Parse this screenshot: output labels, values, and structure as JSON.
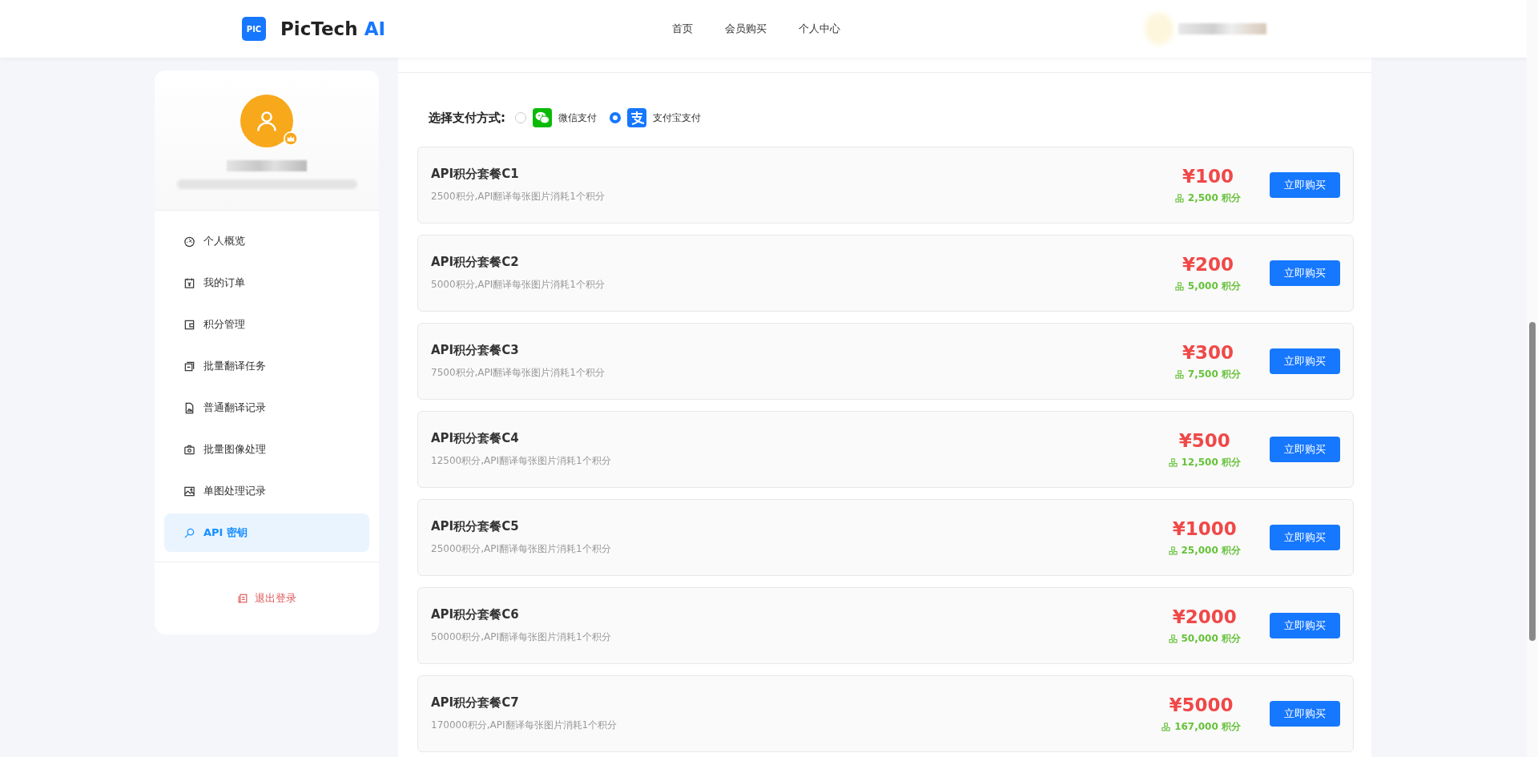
{
  "header": {
    "logo_mark": "PIC",
    "logo_text": "PicTech",
    "logo_accent": "AI",
    "nav": [
      "首页",
      "会员购买",
      "个人中心"
    ]
  },
  "sidebar": {
    "menu": [
      {
        "label": "个人概览",
        "selected": false
      },
      {
        "label": "我的订单",
        "selected": false
      },
      {
        "label": "积分管理",
        "selected": false
      },
      {
        "label": "批量翻译任务",
        "selected": false
      },
      {
        "label": "普通翻译记录",
        "selected": false
      },
      {
        "label": "批量图像处理",
        "selected": false
      },
      {
        "label": "单图处理记录",
        "selected": false
      },
      {
        "label": "API 密钥",
        "selected": true
      }
    ],
    "logout": "退出登录"
  },
  "payment": {
    "label": "选择支付方式:",
    "options": [
      {
        "label": "微信支付",
        "selected": false
      },
      {
        "label": "支付宝支付",
        "selected": true
      }
    ]
  },
  "packages": [
    {
      "title": "API积分套餐C1",
      "description": "2500积分,API翻译每张图片消耗1个积分",
      "price": "¥100",
      "points": "2,500 积分",
      "button": "立即购买"
    },
    {
      "title": "API积分套餐C2",
      "description": "5000积分,API翻译每张图片消耗1个积分",
      "price": "¥200",
      "points": "5,000 积分",
      "button": "立即购买"
    },
    {
      "title": "API积分套餐C3",
      "description": "7500积分,API翻译每张图片消耗1个积分",
      "price": "¥300",
      "points": "7,500 积分",
      "button": "立即购买"
    },
    {
      "title": "API积分套餐C4",
      "description": "12500积分,API翻译每张图片消耗1个积分",
      "price": "¥500",
      "points": "12,500 积分",
      "button": "立即购买"
    },
    {
      "title": "API积分套餐C5",
      "description": "25000积分,API翻译每张图片消耗1个积分",
      "price": "¥1000",
      "points": "25,000 积分",
      "button": "立即购买"
    },
    {
      "title": "API积分套餐C6",
      "description": "50000积分,API翻译每张图片消耗1个积分",
      "price": "¥2000",
      "points": "50,000 积分",
      "button": "立即购买"
    },
    {
      "title": "API积分套餐C7",
      "description": "170000积分,API翻译每张图片消耗1个积分",
      "price": "¥5000",
      "points": "167,000 积分",
      "button": "立即购买"
    }
  ]
}
